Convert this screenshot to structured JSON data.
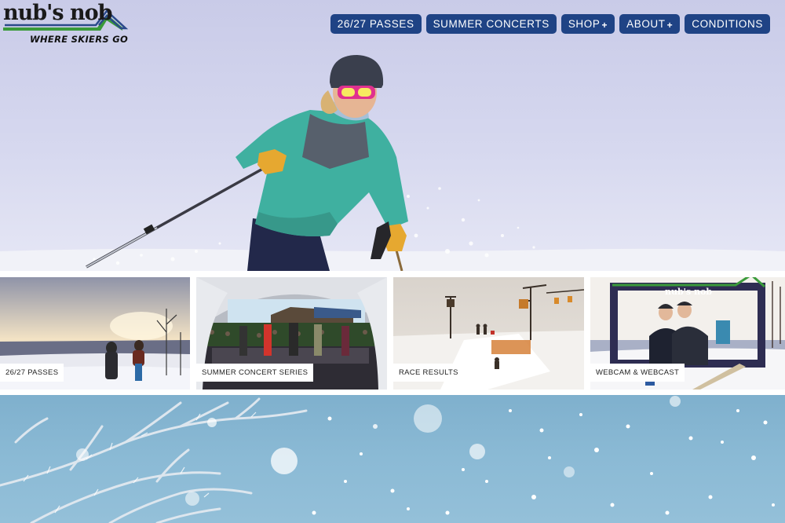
{
  "brand": {
    "name": "nub's nob",
    "tagline": "WHERE SKIERS GO",
    "colors": {
      "green": "#3a9a3a",
      "blue": "#2a4a8a",
      "nav": "#1f4385"
    }
  },
  "nav": {
    "items": [
      {
        "label": "26/27 PASSES",
        "has_plus": false
      },
      {
        "label": "SUMMER CONCERTS",
        "has_plus": false
      },
      {
        "label": "SHOP",
        "has_plus": true
      },
      {
        "label": "ABOUT",
        "has_plus": true
      },
      {
        "label": "CONDITIONS",
        "has_plus": false
      }
    ],
    "plus_glyph": "+"
  },
  "hero": {
    "image": "skier-teal-jacket-powder"
  },
  "tiles": [
    {
      "label": "26/27 PASSES",
      "image": "sunset-couple-hill"
    },
    {
      "label": "SUMMER CONCERT SERIES",
      "image": "concert-tent-stage"
    },
    {
      "label": "RACE RESULTS",
      "image": "race-course-chairlift"
    },
    {
      "label": "WEBCAM & WEBCAST",
      "image": "photo-frame-couple"
    }
  ],
  "webcam_frame_text": "nub's nob",
  "bottom": {
    "image": "frosted-branches-snowfall"
  }
}
